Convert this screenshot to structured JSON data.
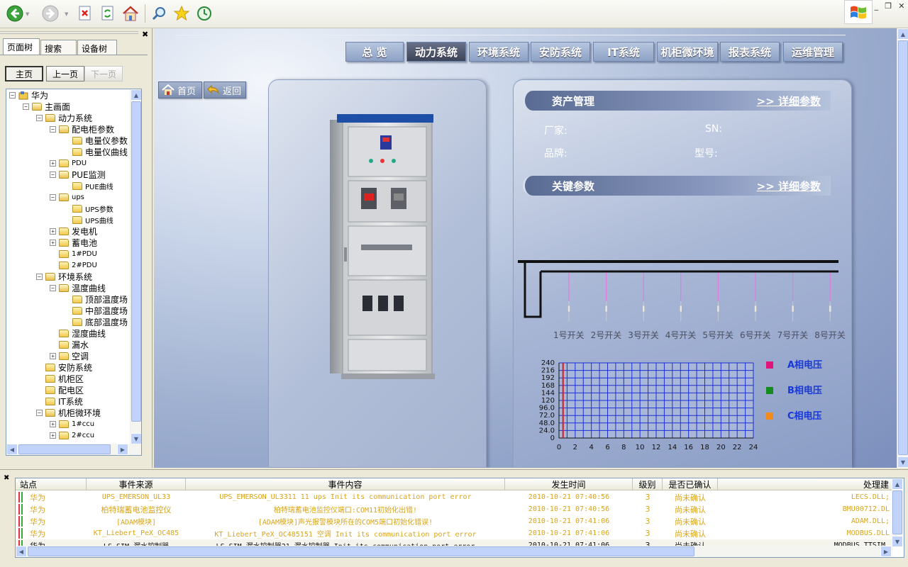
{
  "toolbar": {
    "buttons": [
      "back",
      "forward",
      "stop",
      "refresh",
      "home",
      "search",
      "favorites",
      "history"
    ]
  },
  "left": {
    "tabs": [
      "页面树",
      "搜索",
      "设备树"
    ],
    "nav": {
      "home": "主页",
      "prev": "上一页",
      "next": "下一页"
    },
    "tree": [
      {
        "label": "华为",
        "level": 0,
        "exp": "-",
        "icon": "root"
      },
      {
        "label": "主画面",
        "level": 1,
        "exp": "-",
        "icon": "folder"
      },
      {
        "label": "动力系统",
        "level": 2,
        "exp": "-",
        "icon": "folder"
      },
      {
        "label": "配电柜参数",
        "level": 3,
        "exp": "-",
        "icon": "folder"
      },
      {
        "label": "电量仪参数",
        "level": 4,
        "exp": "",
        "icon": "folder"
      },
      {
        "label": "电量仪曲线",
        "level": 4,
        "exp": "",
        "icon": "folder"
      },
      {
        "label": "PDU",
        "level": 3,
        "exp": "+",
        "icon": "folder",
        "sm": true
      },
      {
        "label": "PUE监测",
        "level": 3,
        "exp": "-",
        "icon": "folder"
      },
      {
        "label": "PUE曲线",
        "level": 4,
        "exp": "",
        "icon": "folder",
        "sm": true
      },
      {
        "label": "ups",
        "level": 3,
        "exp": "-",
        "icon": "folder",
        "sm": true
      },
      {
        "label": "UPS参数",
        "level": 4,
        "exp": "",
        "icon": "folder",
        "sm": true
      },
      {
        "label": "UPS曲线",
        "level": 4,
        "exp": "",
        "icon": "folder",
        "sm": true
      },
      {
        "label": "发电机",
        "level": 3,
        "exp": "+",
        "icon": "folder"
      },
      {
        "label": "蓄电池",
        "level": 3,
        "exp": "+",
        "icon": "folder"
      },
      {
        "label": "1#PDU",
        "level": 3,
        "exp": "",
        "icon": "folder",
        "sm": true
      },
      {
        "label": "2#PDU",
        "level": 3,
        "exp": "",
        "icon": "folder",
        "sm": true
      },
      {
        "label": "环境系统",
        "level": 2,
        "exp": "-",
        "icon": "folder"
      },
      {
        "label": "温度曲线",
        "level": 3,
        "exp": "-",
        "icon": "folder"
      },
      {
        "label": "顶部温度场",
        "level": 4,
        "exp": "",
        "icon": "folder"
      },
      {
        "label": "中部温度场",
        "level": 4,
        "exp": "",
        "icon": "folder"
      },
      {
        "label": "底部温度场",
        "level": 4,
        "exp": "",
        "icon": "folder"
      },
      {
        "label": "湿度曲线",
        "level": 3,
        "exp": "",
        "icon": "folder"
      },
      {
        "label": "漏水",
        "level": 3,
        "exp": "",
        "icon": "folder"
      },
      {
        "label": "空调",
        "level": 3,
        "exp": "+",
        "icon": "folder"
      },
      {
        "label": "安防系统",
        "level": 2,
        "exp": "",
        "icon": "folder"
      },
      {
        "label": "机柜区",
        "level": 2,
        "exp": "",
        "icon": "folder"
      },
      {
        "label": "配电区",
        "level": 2,
        "exp": "",
        "icon": "folder"
      },
      {
        "label": "IT系统",
        "level": 2,
        "exp": "",
        "icon": "folder"
      },
      {
        "label": "机柜微环境",
        "level": 2,
        "exp": "-",
        "icon": "folder"
      },
      {
        "label": "1#ccu",
        "level": 3,
        "exp": "+",
        "icon": "folder",
        "sm": true
      },
      {
        "label": "2#ccu",
        "level": 3,
        "exp": "+",
        "icon": "folder",
        "sm": true
      }
    ]
  },
  "main": {
    "tabs": [
      "总 览",
      "动力系统",
      "环境系统",
      "安防系统",
      "IT系统",
      "机柜微环境",
      "报表系统",
      "运维管理"
    ],
    "active_tab": 1,
    "home_btn": "首页",
    "back_btn": "返回",
    "asset": {
      "title": "资产管理",
      "more": ">> 详细参数",
      "vendor_label": "厂家:",
      "sn_label": "SN:",
      "brand_label": "品牌:",
      "model_label": "型号:"
    },
    "key": {
      "title": "关键参数",
      "more": ">> 详细参数"
    },
    "switches": [
      "1号开关",
      "2号开关",
      "3号开关",
      "4号开关",
      "5号开关",
      "6号开关",
      "7号开关",
      "8号开关"
    ]
  },
  "chart_data": {
    "type": "line",
    "x_ticks": [
      "0",
      "2",
      "4",
      "6",
      "8",
      "10",
      "12",
      "14",
      "16",
      "18",
      "20",
      "22",
      "24"
    ],
    "y_ticks": [
      "0",
      "24.0",
      "48.0",
      "72.0",
      "96.0",
      "120",
      "144",
      "168",
      "192",
      "216",
      "240"
    ],
    "xlim": [
      0,
      24
    ],
    "ylim": [
      0,
      240
    ],
    "grid": true,
    "legend_position": "right",
    "series": [
      {
        "name": "A相电压",
        "color": "#e0147a",
        "values": []
      },
      {
        "name": "B相电压",
        "color": "#158a1f",
        "values": []
      },
      {
        "name": "C相电压",
        "color": "#f28a1c",
        "values": []
      }
    ],
    "current_x": 0.5
  },
  "events": {
    "columns": [
      "站点",
      "事件来源",
      "事件内容",
      "发生时间",
      "级别",
      "是否已确认",
      "处理建"
    ],
    "rows": [
      {
        "site": "华为",
        "source": "UPS_EMERSON_UL33",
        "content": "UPS_EMERSON_UL3311 11 ups Init its communication port error",
        "time": "2010-10-21 07:40:56",
        "level": "3",
        "ack": "尚未确认",
        "handler": "LECS.DLL;",
        "style": "warn"
      },
      {
        "site": "华为",
        "source": "柏特瑞蓄电池监控仪",
        "content": "柏特瑞蓄电池监控仪端口:COM11初始化出错!",
        "time": "2010-10-21 07:40:56",
        "level": "3",
        "ack": "尚未确认",
        "handler": "BMU00712.DL",
        "style": "warn"
      },
      {
        "site": "华为",
        "source": "[ADAM模块]",
        "content": "[ADAM模块]声光报警模块所在的COM5端口初始化错误!",
        "time": "2010-10-21 07:41:06",
        "level": "3",
        "ack": "尚未确认",
        "handler": "ADAM.DLL;",
        "style": "warn"
      },
      {
        "site": "华为",
        "source": "KT_Liebert_PeX_OC485",
        "content": "KT_Liebert_PeX_OC485151 空调 Init its communication port error",
        "time": "2010-10-21 07:41:06",
        "level": "3",
        "ack": "尚未确认",
        "handler": "MODBUS.DLL",
        "style": "warn"
      },
      {
        "site": "华为",
        "source": "LS SIM 漏水控制器",
        "content": "LS SIM 漏水控制器21 漏水控制器 Init its communication port error",
        "time": "2010-10-21 07:41:06",
        "level": "3",
        "ack": "尚未确认",
        "handler": "MODBUS TTSIM.",
        "style": "sel"
      }
    ]
  }
}
